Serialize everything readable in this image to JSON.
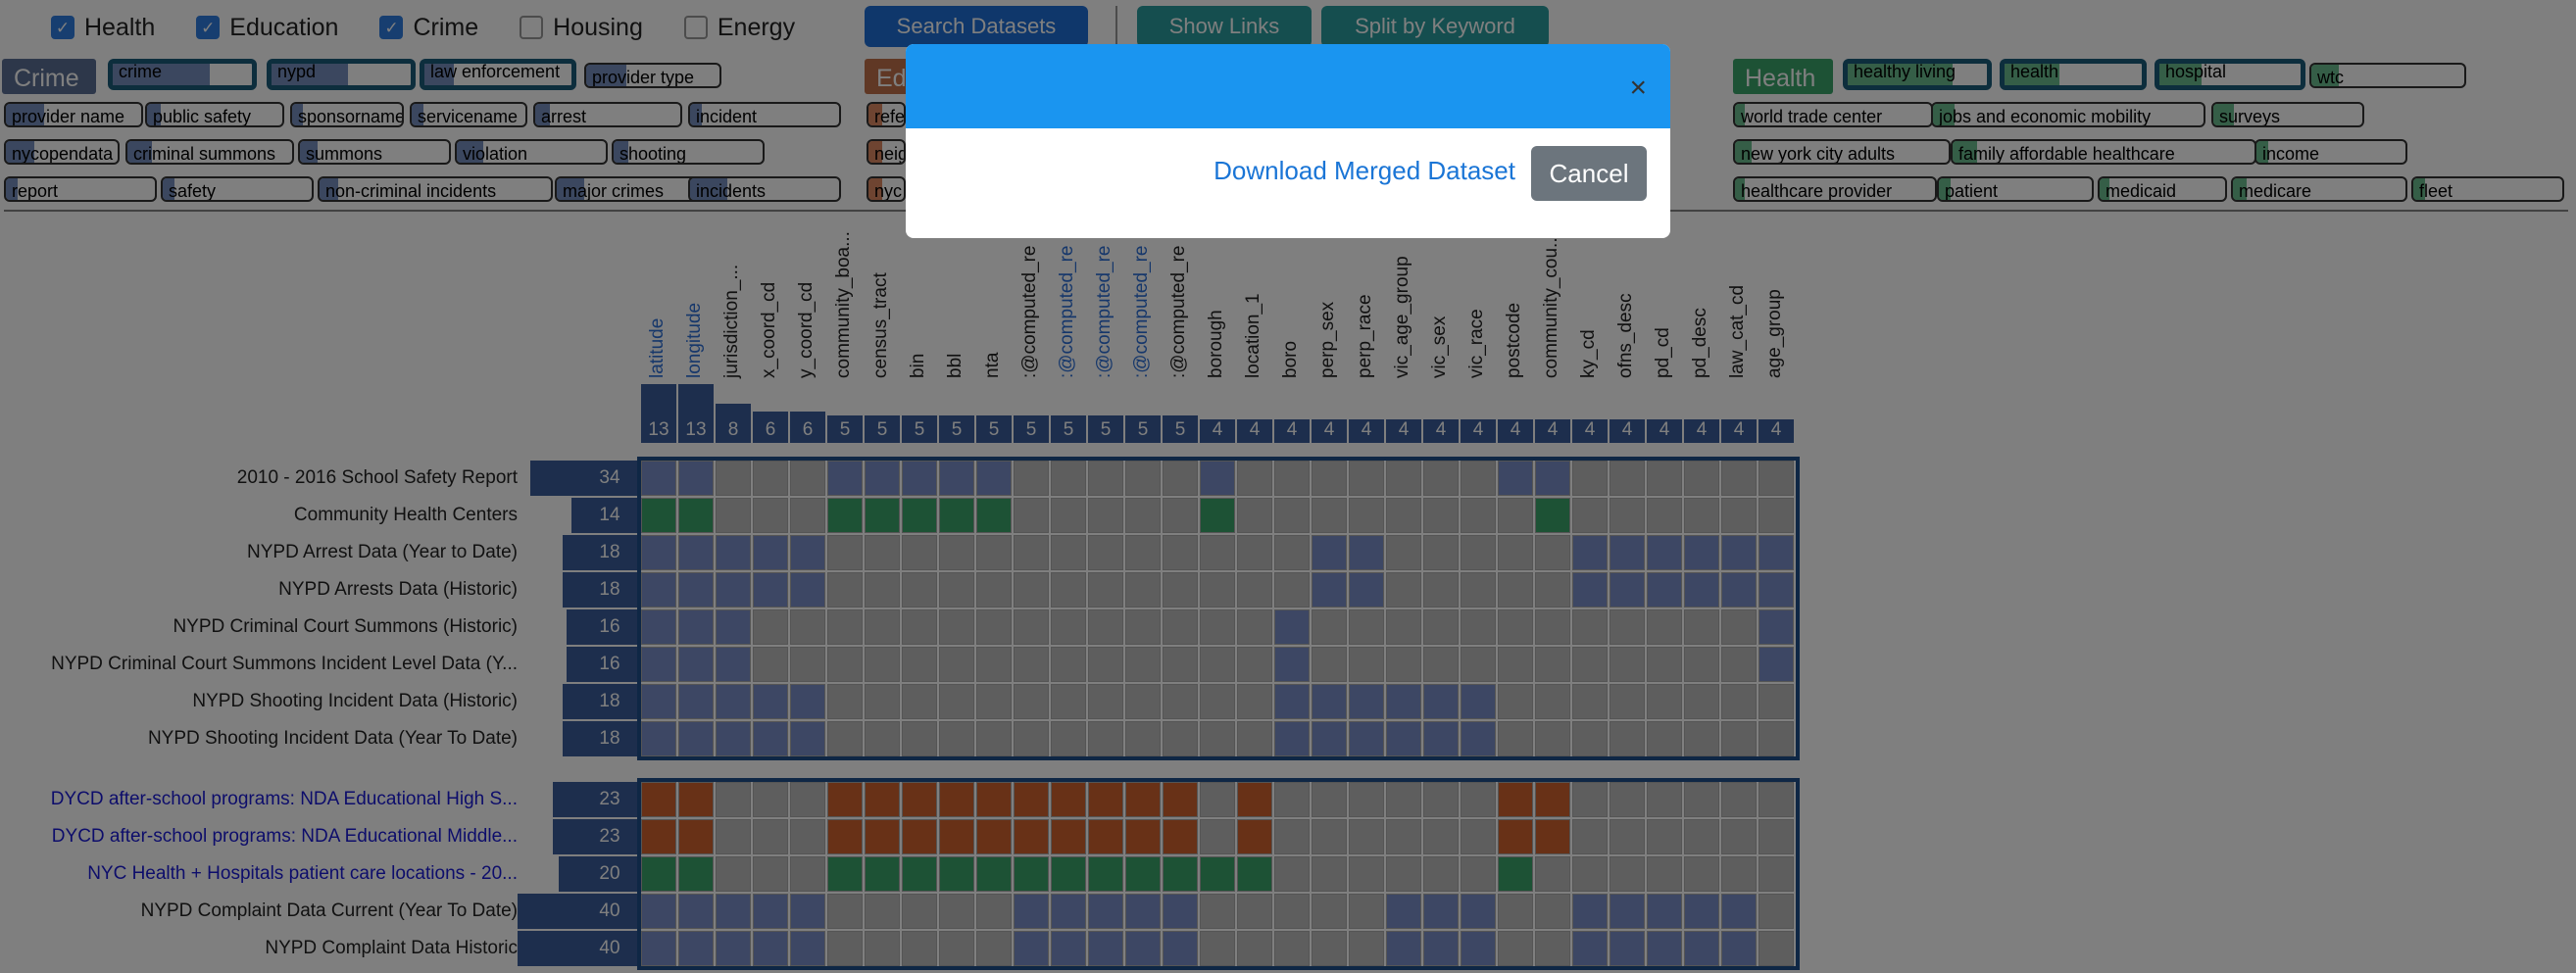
{
  "filters": [
    {
      "label": "Health",
      "checked": true
    },
    {
      "label": "Education",
      "checked": true
    },
    {
      "label": "Crime",
      "checked": true
    },
    {
      "label": "Housing",
      "checked": false
    },
    {
      "label": "Energy",
      "checked": false
    }
  ],
  "buttons": {
    "search": "Search Datasets",
    "show_links": "Show Links",
    "split": "Split by Keyword"
  },
  "colors": {
    "crime": "#4a6aa8",
    "education": "#d0622f",
    "health": "#3aa56a",
    "modal_header": "#1a95f0"
  },
  "panels": {
    "crime": {
      "title": "Crime",
      "tags": [
        "crime",
        "nypd",
        "law enforcement",
        "provider type",
        "provider name",
        "public safety",
        "sponsorname",
        "servicename",
        "arrest",
        "incident",
        "nycopendata",
        "criminal summons",
        "summons",
        "violation",
        "shooting",
        "report",
        "safety",
        "non-criminal incidents",
        "major crimes",
        "incidents"
      ]
    },
    "education": {
      "title": "Ed",
      "tags": [
        "refe",
        "neig",
        "nyc"
      ]
    },
    "health": {
      "title": "Health",
      "tags": [
        "healthy living",
        "health",
        "hospital",
        "wtc",
        "world trade center",
        "jobs and economic mobility",
        "surveys",
        "new york city adults",
        "family affordable healthcare",
        "income",
        "healthcare provider",
        "patient",
        "medicaid",
        "medicare",
        "fleet"
      ]
    }
  },
  "columns": [
    {
      "name": "latitude",
      "count": "13",
      "blue": true
    },
    {
      "name": "longitude",
      "count": "13",
      "blue": true
    },
    {
      "name": "jurisdiction_...",
      "count": "8"
    },
    {
      "name": "x_coord_cd",
      "count": "6"
    },
    {
      "name": "y_coord_cd",
      "count": "6"
    },
    {
      "name": "community_boa...",
      "count": "5"
    },
    {
      "name": "census_tract",
      "count": "5"
    },
    {
      "name": "bin",
      "count": "5"
    },
    {
      "name": "bbl",
      "count": "5"
    },
    {
      "name": "nta",
      "count": "5"
    },
    {
      "name": ":@computed_re",
      "count": "5"
    },
    {
      "name": ":@computed_re",
      "count": "5",
      "blue": true
    },
    {
      "name": ":@computed_re",
      "count": "5",
      "blue": true
    },
    {
      "name": ":@computed_re",
      "count": "5",
      "blue": true
    },
    {
      "name": ":@computed_re",
      "count": "5"
    },
    {
      "name": "borough",
      "count": "4"
    },
    {
      "name": "location_1",
      "count": "4"
    },
    {
      "name": "boro",
      "count": "4"
    },
    {
      "name": "perp_sex",
      "count": "4"
    },
    {
      "name": "perp_race",
      "count": "4"
    },
    {
      "name": "vic_age_group",
      "count": "4"
    },
    {
      "name": "vic_sex",
      "count": "4"
    },
    {
      "name": "vic_race",
      "count": "4"
    },
    {
      "name": "postcode",
      "count": "4"
    },
    {
      "name": "community_cou...",
      "count": "4"
    },
    {
      "name": "ky_cd",
      "count": "4"
    },
    {
      "name": "ofns_desc",
      "count": "4"
    },
    {
      "name": "pd_cd",
      "count": "4"
    },
    {
      "name": "pd_desc",
      "count": "4"
    },
    {
      "name": "law_cat_cd",
      "count": "4"
    },
    {
      "name": "age_group",
      "count": "4"
    }
  ],
  "rows_group1": [
    {
      "label": "2010 - 2016 School Safety Report",
      "count": "34",
      "color": "b",
      "cells": [
        0,
        1,
        5,
        6,
        7,
        8,
        9,
        15,
        23,
        24
      ]
    },
    {
      "label": "Community Health Centers",
      "count": "14",
      "color": "g",
      "cells": [
        0,
        1,
        5,
        6,
        7,
        8,
        9,
        15,
        24
      ]
    },
    {
      "label": "NYPD Arrest Data (Year to Date)",
      "count": "18",
      "color": "b",
      "cells": [
        0,
        1,
        2,
        3,
        4,
        18,
        19,
        25,
        26,
        27,
        28,
        29,
        30
      ]
    },
    {
      "label": "NYPD Arrests Data (Historic)",
      "count": "18",
      "color": "b",
      "cells": [
        0,
        1,
        2,
        3,
        4,
        18,
        19,
        25,
        26,
        27,
        28,
        29,
        30
      ]
    },
    {
      "label": "NYPD Criminal Court Summons (Historic)",
      "count": "16",
      "color": "b",
      "cells": [
        0,
        1,
        2,
        17,
        30
      ]
    },
    {
      "label": "NYPD Criminal Court Summons Incident Level Data (Y...",
      "count": "16",
      "color": "b",
      "cells": [
        0,
        1,
        2,
        17,
        30
      ]
    },
    {
      "label": "NYPD Shooting Incident Data (Historic)",
      "count": "18",
      "color": "b",
      "cells": [
        0,
        1,
        2,
        3,
        4,
        17,
        18,
        19,
        20,
        21,
        22
      ]
    },
    {
      "label": "NYPD Shooting Incident Data (Year To Date)",
      "count": "18",
      "color": "b",
      "cells": [
        0,
        1,
        2,
        3,
        4,
        17,
        18,
        19,
        20,
        21,
        22
      ]
    }
  ],
  "rows_group2": [
    {
      "label": "DYCD after-school programs: NDA Educational High S...",
      "count": "23",
      "color": "o",
      "blue": true,
      "cells": [
        0,
        1,
        5,
        6,
        7,
        8,
        9,
        10,
        11,
        12,
        13,
        14,
        16,
        23,
        24
      ]
    },
    {
      "label": "DYCD after-school programs: NDA Educational Middle...",
      "count": "23",
      "color": "o",
      "blue": true,
      "cells": [
        0,
        1,
        5,
        6,
        7,
        8,
        9,
        10,
        11,
        12,
        13,
        14,
        16,
        23,
        24
      ]
    },
    {
      "label": "NYC Health + Hospitals patient care locations - 20...",
      "count": "20",
      "color": "g",
      "blue": true,
      "cells": [
        0,
        1,
        5,
        6,
        7,
        8,
        9,
        10,
        11,
        12,
        13,
        14,
        15,
        16,
        23
      ]
    },
    {
      "label": "NYPD Complaint Data Current (Year To Date)",
      "count": "40",
      "color": "b",
      "cells": [
        0,
        1,
        2,
        3,
        4,
        10,
        11,
        12,
        13,
        14,
        20,
        21,
        22,
        25,
        26,
        27,
        28,
        29
      ]
    },
    {
      "label": "NYPD Complaint Data Historic",
      "count": "40",
      "color": "b",
      "cells": [
        0,
        1,
        2,
        3,
        4,
        10,
        11,
        12,
        13,
        14,
        20,
        21,
        22,
        25,
        26,
        27,
        28,
        29
      ]
    }
  ],
  "modal": {
    "close": "×",
    "download": "Download Merged Dataset",
    "cancel": "Cancel"
  }
}
